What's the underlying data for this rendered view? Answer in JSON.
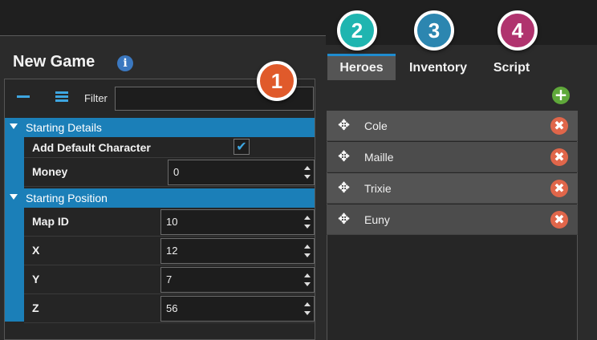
{
  "app": {
    "title": "New Game"
  },
  "filter": {
    "label": "Filter",
    "value": ""
  },
  "categories": [
    {
      "label": "Starting Details"
    },
    {
      "label": "Starting Position"
    }
  ],
  "properties": {
    "add_default_character": {
      "label": "Add Default Character",
      "checked": true,
      "check_glyph": "✔"
    },
    "money": {
      "label": "Money",
      "value": "0"
    },
    "map_id": {
      "label": "Map ID",
      "value": "10"
    },
    "x": {
      "label": "X",
      "value": "12"
    },
    "y": {
      "label": "Y",
      "value": "7"
    },
    "z": {
      "label": "Z",
      "value": "56"
    }
  },
  "tabs": [
    {
      "label": "Heroes",
      "active": true
    },
    {
      "label": "Inventory",
      "active": false
    },
    {
      "label": "Script",
      "active": false
    }
  ],
  "badges": [
    {
      "number": "1",
      "color": "#e05a2b"
    },
    {
      "number": "2",
      "color": "#1fb5b0"
    },
    {
      "number": "3",
      "color": "#2c86b0"
    },
    {
      "number": "4",
      "color": "#b0336e"
    }
  ],
  "heroes": [
    {
      "name": "Cole"
    },
    {
      "name": "Maille"
    },
    {
      "name": "Trixie"
    },
    {
      "name": "Euny"
    }
  ],
  "icons": {
    "info": "i",
    "add": "+",
    "move": "✥",
    "delete": "✖"
  },
  "colors": {
    "accent": "#1b7fb8",
    "tab_underline": "#1f8ccf",
    "delete": "#e0664a",
    "add": "#5fa83a"
  }
}
